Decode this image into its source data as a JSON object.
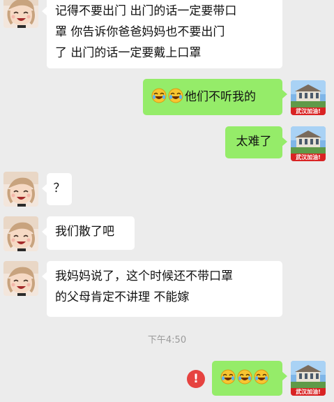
{
  "messages": [
    {
      "side": "left",
      "text": "记得不要出门 出门的话一定要带口罩 你告诉你爸爸妈妈也不要出门了 出门的话一定要戴上口罩"
    },
    {
      "side": "right",
      "text": "他们不听我的",
      "emoji_prefix": [
        "laugh-cry-emoji",
        "laugh-cry-emoji"
      ]
    },
    {
      "side": "right",
      "text": "太难了"
    },
    {
      "side": "left",
      "text": "？"
    },
    {
      "side": "left",
      "text": "我们散了吧"
    },
    {
      "side": "left",
      "text": "我妈妈说了，这个时候还不带口罩的父母肯定不讲理 不能嫁"
    },
    {
      "side": "right",
      "text": "",
      "emoji_prefix": [
        "laugh-cry-emoji",
        "laugh-cry-emoji",
        "laugh-cry-emoji"
      ],
      "failed": true
    }
  ],
  "msg1_line1": "记得不要出门 出门的话一定要带口",
  "msg1_line2": "罩  你告诉你爸爸妈妈也不要出门",
  "msg1_line3": "了 出门的话一定要戴上口罩",
  "msg6_line1": "我妈妈说了，这个时候还不带口罩",
  "msg6_line2": "的父母肯定不讲理  不能嫁",
  "self_avatar_badge": "武汉加油!",
  "timestamp": "下午4:50",
  "error_mark": "!",
  "colors": {
    "bubble_self": "#95ec69",
    "bubble_other": "#ffffff",
    "background": "#ececec",
    "error": "#e64340"
  }
}
